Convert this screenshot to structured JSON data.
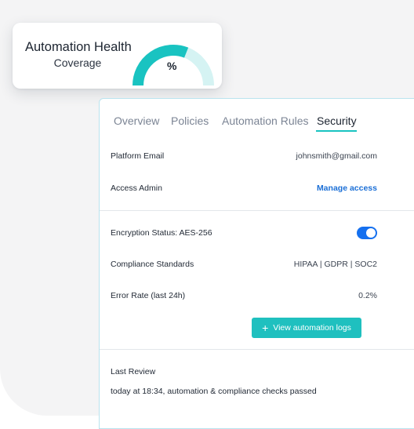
{
  "health_card": {
    "title": "Automation Health",
    "subtitle": "Coverage",
    "gauge_percent_label": "%",
    "gauge_fill_fraction": 0.62,
    "gauge_fill_color": "#19c3c1",
    "gauge_track_color": "#d5f3f3"
  },
  "tabs": [
    {
      "label": "Overview",
      "active": false
    },
    {
      "label": "Policies",
      "active": false
    },
    {
      "label": "Automation Rules",
      "active": false
    },
    {
      "label": "Security",
      "active": true
    }
  ],
  "rows": {
    "platform_email": {
      "label": "Platform Email",
      "value": "johnsmith@gmail.com"
    },
    "access_admin": {
      "label": "Access Admin",
      "link": "Manage access"
    },
    "encryption": {
      "label": "Encryption Status: AES-256",
      "enabled": true
    },
    "compliance": {
      "label": "Compliance Standards",
      "value": "HIPAA | GDPR | SOC2"
    },
    "error_rate": {
      "label": "Error Rate (last 24h)",
      "value": "0.2%"
    }
  },
  "logs_button": {
    "icon": "plus-icon",
    "label": "View automation logs"
  },
  "last_review": {
    "label": "Last Review",
    "text": "today at 18:34, automation & compliance checks passed"
  },
  "colors": {
    "accent": "#19c3c1",
    "toggle": "#1570ef",
    "link": "#1b6fd6"
  }
}
